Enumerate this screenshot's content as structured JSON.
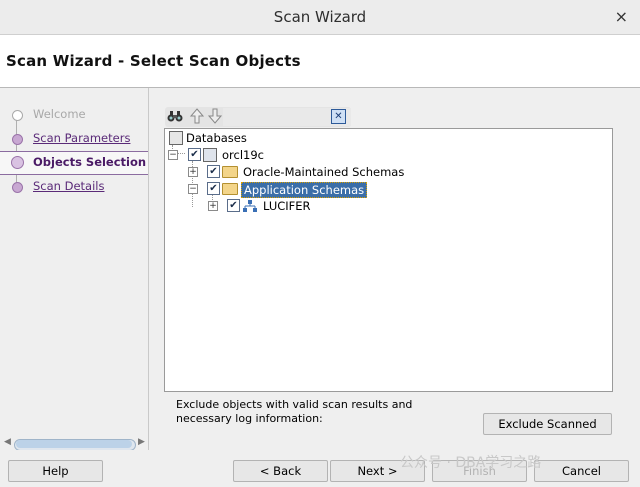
{
  "window": {
    "title": "Scan Wizard",
    "close_glyph": "×"
  },
  "header": {
    "title": "Scan Wizard - Select Scan Objects"
  },
  "sidebar": {
    "steps": [
      {
        "label": "Welcome",
        "state": "disabled"
      },
      {
        "label": "Scan Parameters",
        "state": "link"
      },
      {
        "label": "Objects Selection",
        "state": "active"
      },
      {
        "label": "Scan Details",
        "state": "link"
      }
    ]
  },
  "toolbar": {
    "find_icon": "binoculars-icon",
    "up_icon": "arrow-up-icon",
    "down_icon": "arrow-down-icon",
    "clear_icon": "clear-icon"
  },
  "tree": {
    "root_label": "Databases",
    "db_label": "orcl19c",
    "folder1_label": "Oracle-Maintained Schemas",
    "folder2_label": "Application Schemas",
    "schema_label": "LUCIFER",
    "selected_node": "Application Schemas"
  },
  "exclude": {
    "text_line1": "Exclude objects with valid scan results and",
    "text_line2": "necessary log information:",
    "button_label": "Exclude Scanned"
  },
  "buttons": {
    "help": "Help",
    "back": "< Back",
    "next": "Next >",
    "finish": "Finish",
    "cancel": "Cancel"
  },
  "watermark": "公众号 · DBA学习之路",
  "colors": {
    "accent": "#5a2a78",
    "selection": "#3b6ea8"
  }
}
